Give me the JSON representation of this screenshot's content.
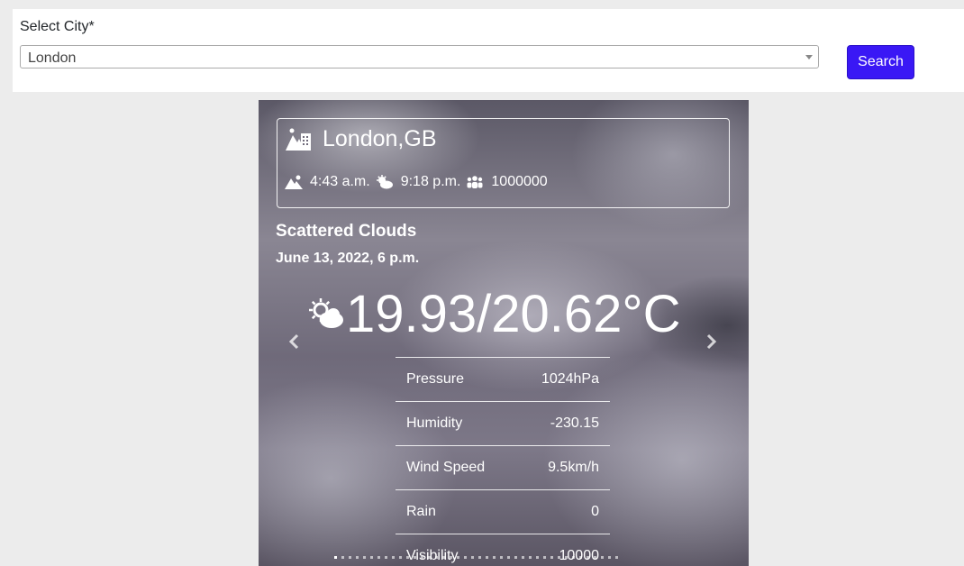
{
  "search": {
    "label": "Select City*",
    "selected_city": "London",
    "button_label": "Search",
    "button_color": "#3a18f5"
  },
  "card": {
    "location": "London,GB",
    "sunrise": "4:43 a.m.",
    "sunset": "9:18 p.m.",
    "population": "1000000",
    "condition": "Scattered Clouds",
    "datetime": "June 13, 2022, 6 p.m.",
    "temperature": "19.93/20.62°C",
    "stats": [
      {
        "label": "Pressure",
        "value": "1024hPa"
      },
      {
        "label": "Humidity",
        "value": "-230.15"
      },
      {
        "label": "Wind Speed",
        "value": "9.5km/h"
      },
      {
        "label": "Rain",
        "value": "0"
      },
      {
        "label": "Visibility",
        "value": "10000"
      }
    ],
    "icons": {
      "city": "city-icon",
      "sunrise": "mountain-sun-icon",
      "sunset": "cloud-sun-icon",
      "population": "people-group-icon",
      "weather": "cloud-sun-icon",
      "prev": "chevron-left-icon",
      "next": "chevron-right-icon"
    },
    "slide_count": 40,
    "active_slide": 1
  }
}
